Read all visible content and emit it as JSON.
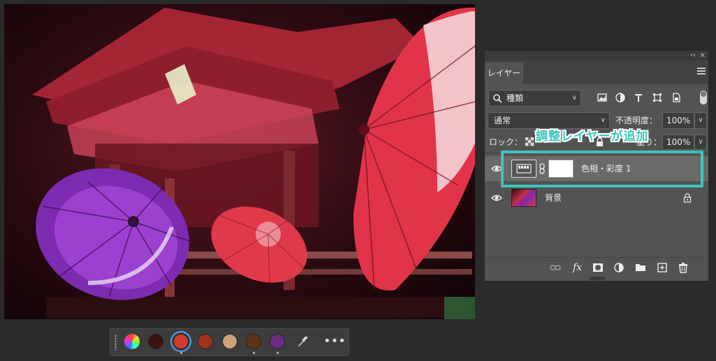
{
  "swatches": {
    "colors": [
      "#3a1410",
      "#d43b2c",
      "#9c3419",
      "#d1a278",
      "#5a3318",
      "#6e2a8c"
    ],
    "selected_index": 1,
    "dotted_indices": [
      1,
      4,
      5
    ],
    "more_label": "•••"
  },
  "layers_panel": {
    "collapse_label": "‹‹",
    "close_label": "×",
    "tab_label": "レイヤー",
    "filter_label": "種類",
    "blend_mode": "通常",
    "opacity_label": "不透明度：",
    "opacity_value": "100%",
    "lock_label": "ロック：",
    "fill_label": "塗り：",
    "fill_value": "100%",
    "layers": [
      {
        "name": "色相・彩度 1",
        "selected": true
      },
      {
        "name": "背景",
        "selected": false
      }
    ],
    "footer_fx_label": "fx"
  },
  "annotation": {
    "text": "調整レイヤーが追加",
    "color": "#3ec5bb"
  }
}
